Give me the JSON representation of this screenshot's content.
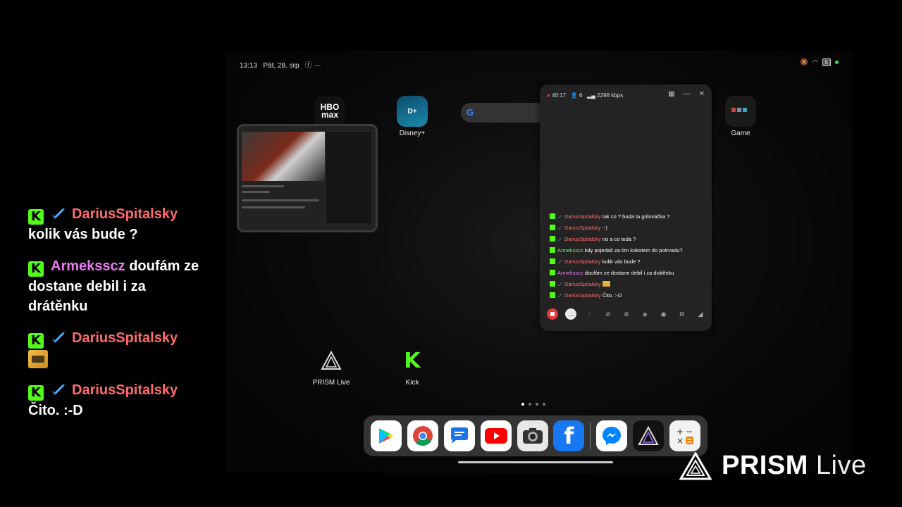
{
  "overlay_chat": [
    {
      "username": "DariusSpitalsky",
      "user_color": "#ff6b6b",
      "badges": [
        "kick-badge",
        "sword-badge"
      ],
      "message": "kolik vás bude ?"
    },
    {
      "username": "Armeksscz",
      "user_color": "#e879f0",
      "badges": [
        "kick-badge"
      ],
      "message": "doufám ze dostane debil i za drátěnku"
    },
    {
      "username": "DariusSpitalsky",
      "user_color": "#ff6b6b",
      "badges": [
        "kick-badge",
        "sword-badge"
      ],
      "message": "",
      "emote": "emote-image"
    },
    {
      "username": "DariusSpitalsky",
      "user_color": "#ff6b6b",
      "badges": [
        "kick-badge",
        "sword-badge"
      ],
      "message": "Čito. :-D"
    }
  ],
  "status_bar": {
    "time": "13:13",
    "date": "Pát, 28. srp",
    "dots": "···",
    "battery": "5"
  },
  "home_apps": {
    "hbo": {
      "label": "HBO max"
    },
    "disney": {
      "label": "Disney+"
    },
    "game": {
      "label": "Game"
    },
    "prism": {
      "label": "PRISM Live"
    },
    "kick": {
      "label": "Kick"
    }
  },
  "prism_panel": {
    "stream_time": "40:17",
    "viewers": "6",
    "bitrate": "2296 kbps",
    "chat": [
      {
        "username": "DariusSpitalsky",
        "user_color": "#ff6b6b",
        "sword": true,
        "message": "tak co ? buda ta grilovačka ?"
      },
      {
        "username": "DariusSpitalsky",
        "user_color": "#ff6b6b",
        "sword": true,
        "message": ":-)"
      },
      {
        "username": "DariusSpitalsky",
        "user_color": "#ff6b6b",
        "sword": true,
        "message": "no a co teda ?"
      },
      {
        "username": "Armeksscz",
        "user_color": "#7be37b",
        "sword": false,
        "message": "kdy pojedaš za tím kokotem do potrvadu?"
      },
      {
        "username": "DariusSpitalsky",
        "user_color": "#ff6b6b",
        "sword": true,
        "message": "kolik vás bude ?"
      },
      {
        "username": "Armeksscz",
        "user_color": "#e879f0",
        "sword": false,
        "message": "doufám ze dostane debil i za drátěnku"
      },
      {
        "username": "DariusSpitalsky",
        "user_color": "#ff6b6b",
        "sword": true,
        "message": "",
        "emote": true
      },
      {
        "username": "DariusSpitalsky",
        "user_color": "#ff6b6b",
        "sword": true,
        "message": "Čito. :-D"
      }
    ]
  },
  "dock": [
    "play-store",
    "chrome",
    "messages",
    "youtube",
    "camera",
    "facebook",
    "messenger",
    "prism-live",
    "calculator"
  ],
  "watermark": {
    "bold": "PRISM",
    "light": " Live"
  },
  "colors": {
    "kick_green": "#53fc18",
    "record_red": "#e53935"
  }
}
